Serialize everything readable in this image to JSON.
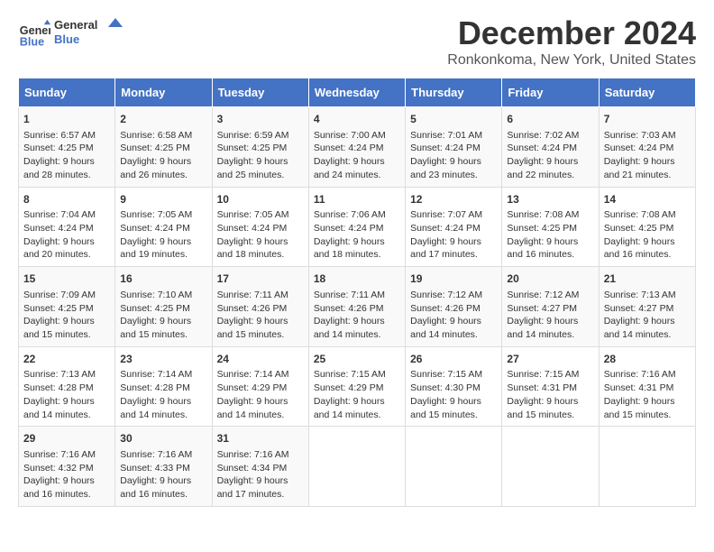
{
  "header": {
    "logo_line1": "General",
    "logo_line2": "Blue",
    "title": "December 2024",
    "subtitle": "Ronkonkoma, New York, United States"
  },
  "days_of_week": [
    "Sunday",
    "Monday",
    "Tuesday",
    "Wednesday",
    "Thursday",
    "Friday",
    "Saturday"
  ],
  "weeks": [
    [
      {
        "day": "1",
        "sunrise": "6:57 AM",
        "sunset": "4:25 PM",
        "daylight": "9 hours and 28 minutes."
      },
      {
        "day": "2",
        "sunrise": "6:58 AM",
        "sunset": "4:25 PM",
        "daylight": "9 hours and 26 minutes."
      },
      {
        "day": "3",
        "sunrise": "6:59 AM",
        "sunset": "4:25 PM",
        "daylight": "9 hours and 25 minutes."
      },
      {
        "day": "4",
        "sunrise": "7:00 AM",
        "sunset": "4:24 PM",
        "daylight": "9 hours and 24 minutes."
      },
      {
        "day": "5",
        "sunrise": "7:01 AM",
        "sunset": "4:24 PM",
        "daylight": "9 hours and 23 minutes."
      },
      {
        "day": "6",
        "sunrise": "7:02 AM",
        "sunset": "4:24 PM",
        "daylight": "9 hours and 22 minutes."
      },
      {
        "day": "7",
        "sunrise": "7:03 AM",
        "sunset": "4:24 PM",
        "daylight": "9 hours and 21 minutes."
      }
    ],
    [
      {
        "day": "8",
        "sunrise": "7:04 AM",
        "sunset": "4:24 PM",
        "daylight": "9 hours and 20 minutes."
      },
      {
        "day": "9",
        "sunrise": "7:05 AM",
        "sunset": "4:24 PM",
        "daylight": "9 hours and 19 minutes."
      },
      {
        "day": "10",
        "sunrise": "7:05 AM",
        "sunset": "4:24 PM",
        "daylight": "9 hours and 18 minutes."
      },
      {
        "day": "11",
        "sunrise": "7:06 AM",
        "sunset": "4:24 PM",
        "daylight": "9 hours and 18 minutes."
      },
      {
        "day": "12",
        "sunrise": "7:07 AM",
        "sunset": "4:24 PM",
        "daylight": "9 hours and 17 minutes."
      },
      {
        "day": "13",
        "sunrise": "7:08 AM",
        "sunset": "4:25 PM",
        "daylight": "9 hours and 16 minutes."
      },
      {
        "day": "14",
        "sunrise": "7:08 AM",
        "sunset": "4:25 PM",
        "daylight": "9 hours and 16 minutes."
      }
    ],
    [
      {
        "day": "15",
        "sunrise": "7:09 AM",
        "sunset": "4:25 PM",
        "daylight": "9 hours and 15 minutes."
      },
      {
        "day": "16",
        "sunrise": "7:10 AM",
        "sunset": "4:25 PM",
        "daylight": "9 hours and 15 minutes."
      },
      {
        "day": "17",
        "sunrise": "7:11 AM",
        "sunset": "4:26 PM",
        "daylight": "9 hours and 15 minutes."
      },
      {
        "day": "18",
        "sunrise": "7:11 AM",
        "sunset": "4:26 PM",
        "daylight": "9 hours and 14 minutes."
      },
      {
        "day": "19",
        "sunrise": "7:12 AM",
        "sunset": "4:26 PM",
        "daylight": "9 hours and 14 minutes."
      },
      {
        "day": "20",
        "sunrise": "7:12 AM",
        "sunset": "4:27 PM",
        "daylight": "9 hours and 14 minutes."
      },
      {
        "day": "21",
        "sunrise": "7:13 AM",
        "sunset": "4:27 PM",
        "daylight": "9 hours and 14 minutes."
      }
    ],
    [
      {
        "day": "22",
        "sunrise": "7:13 AM",
        "sunset": "4:28 PM",
        "daylight": "9 hours and 14 minutes."
      },
      {
        "day": "23",
        "sunrise": "7:14 AM",
        "sunset": "4:28 PM",
        "daylight": "9 hours and 14 minutes."
      },
      {
        "day": "24",
        "sunrise": "7:14 AM",
        "sunset": "4:29 PM",
        "daylight": "9 hours and 14 minutes."
      },
      {
        "day": "25",
        "sunrise": "7:15 AM",
        "sunset": "4:29 PM",
        "daylight": "9 hours and 14 minutes."
      },
      {
        "day": "26",
        "sunrise": "7:15 AM",
        "sunset": "4:30 PM",
        "daylight": "9 hours and 15 minutes."
      },
      {
        "day": "27",
        "sunrise": "7:15 AM",
        "sunset": "4:31 PM",
        "daylight": "9 hours and 15 minutes."
      },
      {
        "day": "28",
        "sunrise": "7:16 AM",
        "sunset": "4:31 PM",
        "daylight": "9 hours and 15 minutes."
      }
    ],
    [
      {
        "day": "29",
        "sunrise": "7:16 AM",
        "sunset": "4:32 PM",
        "daylight": "9 hours and 16 minutes."
      },
      {
        "day": "30",
        "sunrise": "7:16 AM",
        "sunset": "4:33 PM",
        "daylight": "9 hours and 16 minutes."
      },
      {
        "day": "31",
        "sunrise": "7:16 AM",
        "sunset": "4:34 PM",
        "daylight": "9 hours and 17 minutes."
      },
      null,
      null,
      null,
      null
    ]
  ]
}
